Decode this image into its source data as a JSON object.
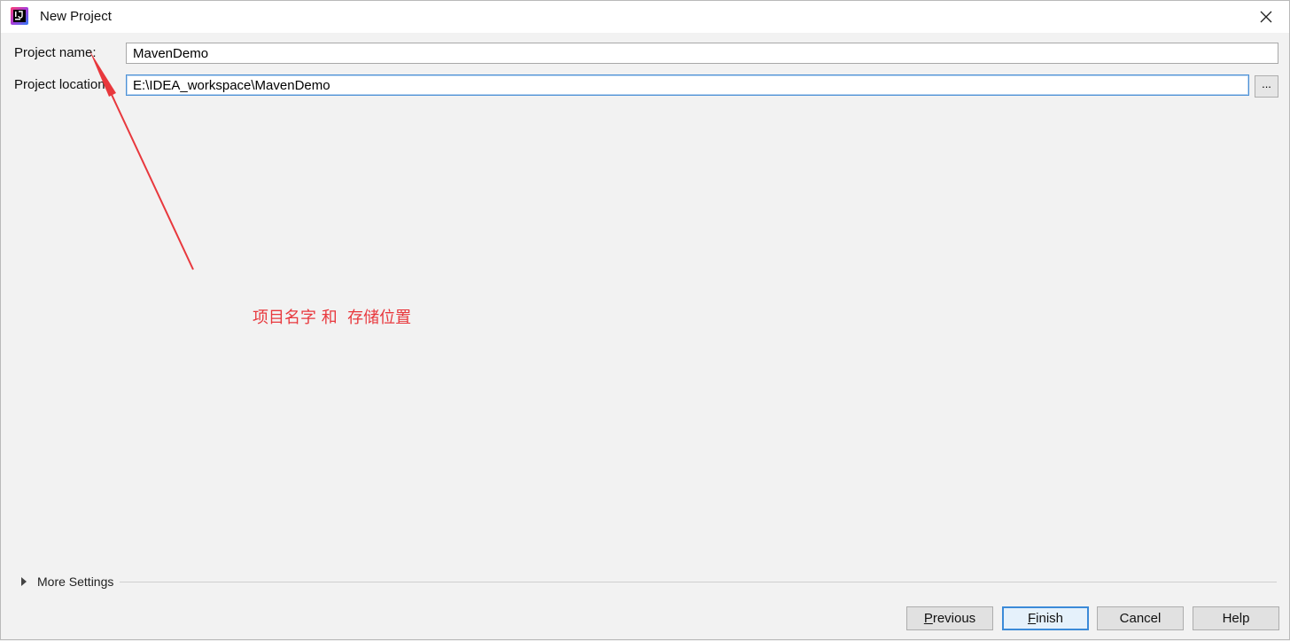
{
  "window": {
    "title": "New Project",
    "icon": "intellij-idea-icon",
    "close_icon": "close-icon"
  },
  "form": {
    "name_label": "Project name:",
    "name_value": "MavenDemo",
    "location_label": "Project location:",
    "location_value": "E:\\IDEA_workspace\\MavenDemo",
    "browse_label": "..."
  },
  "annotation": {
    "text": "项目名字 和  存储位置",
    "color": "#e8383d"
  },
  "more_settings": {
    "label": "More Settings",
    "expanded": false
  },
  "footer": {
    "previous_first": "P",
    "previous_rest": "revious",
    "finish_first": "F",
    "finish_rest": "inish",
    "cancel_label": "Cancel",
    "help_label": "Help"
  },
  "colors": {
    "focus_border": "#4d91d6",
    "default_button_border": "#3b8ad8"
  }
}
